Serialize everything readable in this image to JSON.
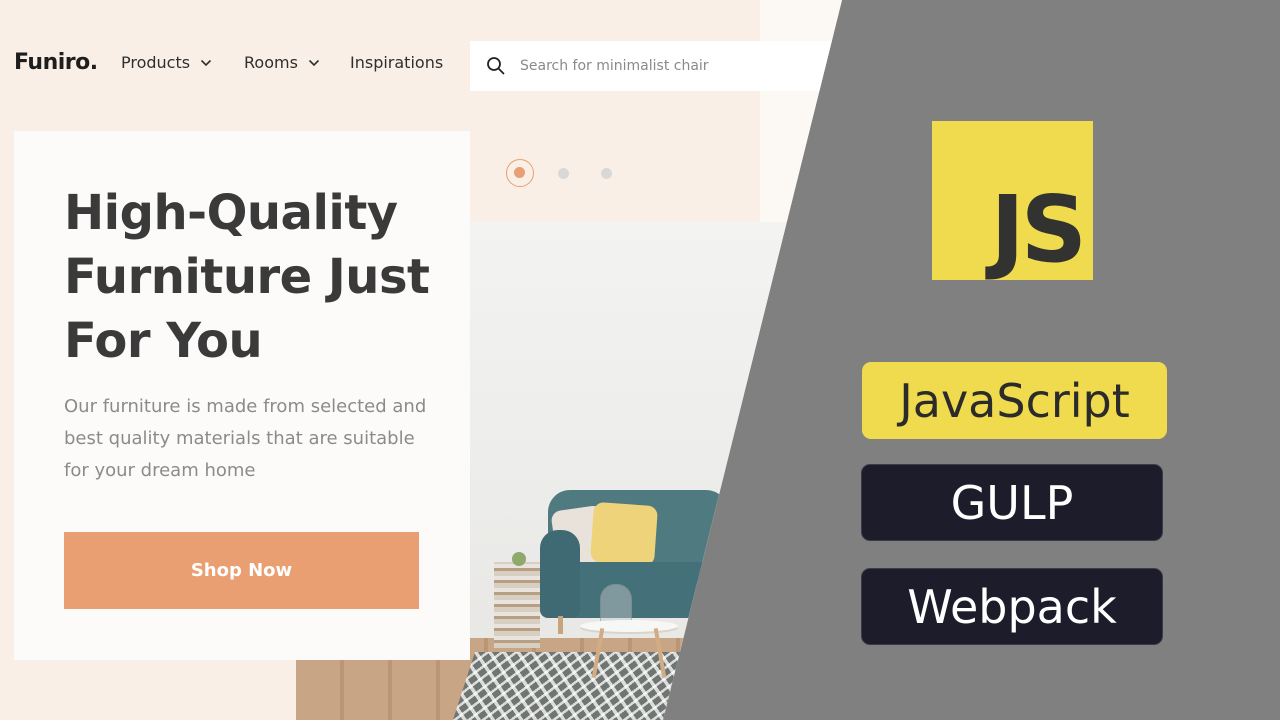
{
  "site": {
    "logo": "Funiro.",
    "nav": [
      {
        "label": "Products",
        "has_dropdown": true
      },
      {
        "label": "Rooms",
        "has_dropdown": true
      },
      {
        "label": "Inspirations",
        "has_dropdown": false
      }
    ],
    "search": {
      "placeholder": "Search for minimalist chair",
      "value": "",
      "icon": "search-icon"
    },
    "hero": {
      "title": "High-Quality Furniture Just For You",
      "description": "Our furniture is made from selected and best quality materials that are suitable for your dream home",
      "cta_label": "Shop Now"
    },
    "slider": {
      "count": 3,
      "active_index": 0
    }
  },
  "overlay": {
    "js_logo_text": "JS",
    "badges": [
      {
        "label": "JavaScript"
      },
      {
        "label": "GULP"
      },
      {
        "label": "Webpack"
      }
    ]
  },
  "colors": {
    "accent": "#e99f71",
    "js_yellow": "#f0db4f",
    "badge_dark": "#1c1c2b",
    "panel_gray": "#808080",
    "peach": "#f9efe6"
  }
}
